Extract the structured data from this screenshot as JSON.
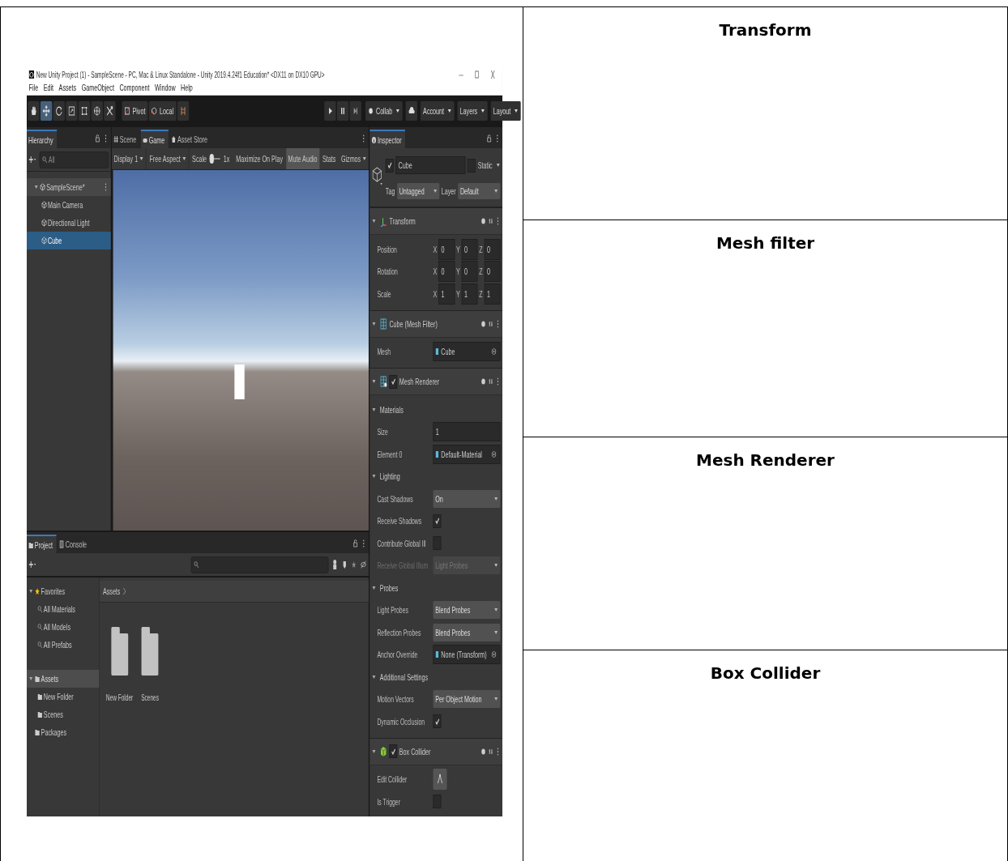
{
  "right_column": [
    {
      "heading": "Transform"
    },
    {
      "heading": "Mesh filter"
    },
    {
      "heading": "Mesh Renderer"
    },
    {
      "heading": "Box Collider"
    }
  ],
  "unity": {
    "window": {
      "title": "New Unity Project (1) - SampleScene - PC, Mac & Linux Standalone - Unity 2019.4.24f1 Education* <DX11 on DX10 GPU>"
    },
    "menu": [
      "File",
      "Edit",
      "Assets",
      "GameObject",
      "Component",
      "Window",
      "Help"
    ],
    "toolbar": {
      "tools": [
        {
          "kind": "hand",
          "selected": false
        },
        {
          "kind": "move",
          "selected": true
        },
        {
          "kind": "rotate",
          "selected": false
        },
        {
          "kind": "scale",
          "selected": false
        },
        {
          "kind": "rect",
          "selected": false
        },
        {
          "kind": "transform",
          "selected": false
        },
        {
          "kind": "custom",
          "selected": false
        }
      ],
      "pivot": "Pivot",
      "local": "Local",
      "collab": "Collab",
      "account": "Account",
      "layers": "Layers",
      "layout": "Layout"
    },
    "hierarchy": {
      "tab": "Hierarchy",
      "search": "All",
      "tree": [
        {
          "label": "SampleScene*",
          "expanded": true,
          "selected": false,
          "children": [
            {
              "label": "Main Camera",
              "selected": false
            },
            {
              "label": "Directional Light",
              "selected": false
            },
            {
              "label": "Cube",
              "selected": true
            }
          ]
        }
      ]
    },
    "game_view": {
      "tabs": [
        {
          "label": "Scene",
          "selected": false
        },
        {
          "label": "Game",
          "selected": true
        },
        {
          "label": "Asset Store",
          "selected": false
        }
      ],
      "display": "Display 1",
      "aspect": "Free Aspect",
      "scale_label": "Scale",
      "scale": {
        "level": 0
      },
      "scale_value": "1x",
      "toggles": [
        {
          "label": "Maximize On Play",
          "on": false
        },
        {
          "label": "Mute Audio",
          "on": true
        },
        {
          "label": "Stats",
          "on": false
        }
      ],
      "gizmos": "Gizmos"
    },
    "project": {
      "tabs": [
        {
          "label": "Project",
          "selected": true
        },
        {
          "label": "Console",
          "selected": false
        }
      ],
      "tree": [
        {
          "label": "Favorites",
          "kind": "favorites",
          "expanded": true,
          "selected": false,
          "children": [
            {
              "label": "All Materials",
              "kind": "search",
              "selected": false
            },
            {
              "label": "All Models",
              "kind": "search",
              "selected": false
            },
            {
              "label": "All Prefabs",
              "kind": "search",
              "selected": false
            }
          ]
        },
        {
          "label": "Assets",
          "kind": "folder",
          "expanded": true,
          "selected": true,
          "children": [
            {
              "label": "New Folder",
              "kind": "folder",
              "selected": false
            },
            {
              "label": "Scenes",
              "kind": "folder",
              "selected": false
            }
          ]
        },
        {
          "label": "Packages",
          "kind": "folder",
          "selected": false
        }
      ],
      "breadcrumb": "Assets",
      "items": [
        {
          "label": "New Folder"
        },
        {
          "label": "Scenes"
        }
      ]
    },
    "inspector": {
      "tab": "Inspector",
      "object": {
        "active": true,
        "name": "Cube",
        "static": false,
        "static_label": "Static",
        "tag_label": "Tag",
        "tag": "Untagged",
        "layer_label": "Layer",
        "layer": "Default"
      },
      "components": [
        {
          "kind": "transform",
          "title": "Transform",
          "props": [
            {
              "kind": "vec3",
              "label": "Position",
              "fields": [
                {
                  "axis": "X",
                  "value": "0"
                },
                {
                  "axis": "Y",
                  "value": "0"
                },
                {
                  "axis": "Z",
                  "value": "0"
                }
              ]
            },
            {
              "kind": "vec3",
              "label": "Rotation",
              "fields": [
                {
                  "axis": "X",
                  "value": "0"
                },
                {
                  "axis": "Y",
                  "value": "0"
                },
                {
                  "axis": "Z",
                  "value": "0"
                }
              ]
            },
            {
              "kind": "vec3",
              "label": "Scale",
              "fields": [
                {
                  "axis": "X",
                  "value": "1"
                },
                {
                  "axis": "Y",
                  "value": "1"
                },
                {
                  "axis": "Z",
                  "value": "1"
                }
              ]
            }
          ]
        },
        {
          "kind": "mesh_filter",
          "title": "Cube (Mesh Filter)",
          "props": [
            {
              "kind": "object",
              "label": "Mesh",
              "value": "Cube"
            }
          ]
        },
        {
          "kind": "mesh_renderer",
          "title": "Mesh Renderer",
          "enabled": true,
          "props": [
            {
              "kind": "section",
              "label": "Materials"
            },
            {
              "kind": "field",
              "label": "Size",
              "value": "1"
            },
            {
              "kind": "object",
              "label": "Element 0",
              "value": "Default-Material"
            },
            {
              "kind": "section",
              "label": "Lighting"
            },
            {
              "kind": "dropdown",
              "label": "Cast Shadows",
              "value": "On",
              "disabled": false
            },
            {
              "kind": "checkbox",
              "label": "Receive Shadows",
              "checked": true
            },
            {
              "kind": "checkbox",
              "label": "Contribute Global Ill",
              "checked": false
            },
            {
              "kind": "dropdown",
              "label": "Receive Global Illum",
              "value": "Light Probes",
              "disabled": true
            },
            {
              "kind": "section",
              "label": "Probes"
            },
            {
              "kind": "dropdown",
              "label": "Light Probes",
              "value": "Blend Probes",
              "disabled": false
            },
            {
              "kind": "dropdown",
              "label": "Reflection Probes",
              "value": "Blend Probes",
              "disabled": false
            },
            {
              "kind": "object",
              "label": "Anchor Override",
              "value": "None (Transform)"
            },
            {
              "kind": "section",
              "label": "Additional Settings"
            },
            {
              "kind": "dropdown",
              "label": "Motion Vectors",
              "value": "Per Object Motion",
              "disabled": false
            },
            {
              "kind": "checkbox",
              "label": "Dynamic Occlusion",
              "checked": true
            }
          ]
        },
        {
          "kind": "box_collider",
          "title": "Box Collider",
          "enabled": true,
          "props": [
            {
              "kind": "button",
              "label": "Edit Collider"
            },
            {
              "kind": "checkbox",
              "label": "Is Trigger",
              "checked": false
            }
          ]
        }
      ]
    }
  }
}
